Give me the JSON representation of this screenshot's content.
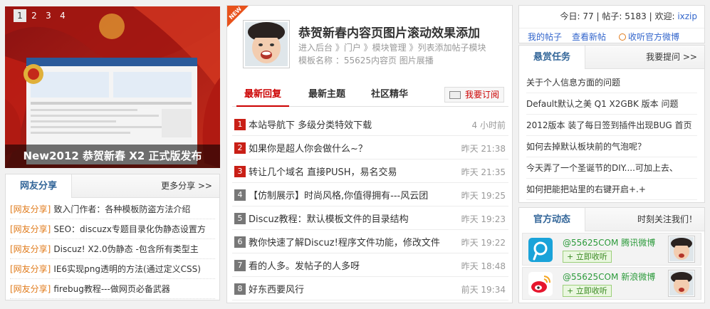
{
  "slider": {
    "pages": [
      "1",
      "2",
      "3",
      "4"
    ],
    "active_page": "1",
    "caption": "New2012 恭贺新春 X2 正式版发布"
  },
  "share": {
    "title": "网友分享",
    "more": "更多分享 >>",
    "items": [
      {
        "tag": "[网友分享]",
        "text": "致入门作者：各种模板防盗方法介绍"
      },
      {
        "tag": "[网友分享]",
        "text": "SEO：discuzx专题目录化伪静态设置方"
      },
      {
        "tag": "[网友分享]",
        "text": "Discuz! X2.0伪静态 -包含所有类型主"
      },
      {
        "tag": "[网友分享]",
        "text": "IE6实现png透明的方法(通过定义CSS)"
      },
      {
        "tag": "[网友分享]",
        "text": "firebug教程---做网页必备武器"
      }
    ]
  },
  "feature": {
    "badge": "NEW",
    "title": "恭贺新春内容页图片滚动效果添加",
    "crumb": "进入后台 》门户 》模块管理 》列表添加帖子模块",
    "template": "模板名称 ：55625内容页 图片展播"
  },
  "tabs": [
    {
      "label": "最新回复",
      "active": true
    },
    {
      "label": "最新主题",
      "active": false
    },
    {
      "label": "社区精华",
      "active": false
    }
  ],
  "subscribe_label": "我要订阅",
  "threads": [
    {
      "num": "1",
      "title": "本站导航下 多级分类特效下载",
      "time": "4 小时前",
      "hot": true
    },
    {
      "num": "2",
      "title": "如果你是超人你会做什么~？",
      "time": "昨天 21:38",
      "hot": true
    },
    {
      "num": "3",
      "title": "转让几个域名 直接PUSH，易名交易",
      "time": "昨天 21:35",
      "hot": true
    },
    {
      "num": "4",
      "title": "【仿制展示】时尚风格,你值得拥有---风云团",
      "time": "昨天 19:25",
      "hot": false
    },
    {
      "num": "5",
      "title": "Discuz教程：默认模板文件的目录结构",
      "time": "昨天 19:23",
      "hot": false
    },
    {
      "num": "6",
      "title": "教你快速了解Discuz!程序文件功能，修改文件",
      "time": "昨天 19:22",
      "hot": false
    },
    {
      "num": "7",
      "title": "看的人多。发帖子的人多呀",
      "time": "昨天 18:48",
      "hot": false
    },
    {
      "num": "8",
      "title": "好东西要风行",
      "time": "前天 19:34",
      "hot": false
    }
  ],
  "userbar": {
    "today": "今日: 77",
    "posts": "帖子: 5183",
    "welcome": "欢迎:",
    "username": "ixzip",
    "my_posts": "我的帖子",
    "view_new": "查看新帖",
    "listen_weibo": "收听官方微博"
  },
  "tasks": {
    "title": "悬赏任务",
    "more": "我要提问 >>",
    "items": [
      "关于个人信息方面的问题",
      "Default默认之美 Q1 X2GBK 版本 问题",
      "2012版本 装了每日签到插件出现BUG 首页",
      "如何去掉默认板块前的气泡呢？",
      "今天弄了一个圣诞节的DIY....可加上去、",
      "如何把能把站里的右键开启+.+"
    ]
  },
  "official": {
    "title": "官方动态",
    "more": "时刻关注我们！",
    "accounts": [
      {
        "logo": "qq-weibo-icon",
        "handle": "@55625COM",
        "platform": "腾讯微博",
        "follow": "+ 立即收听",
        "color": "#1aa3d9"
      },
      {
        "logo": "sina-weibo-icon",
        "handle": "@55625COM",
        "platform": "新浪微博",
        "follow": "+ 立即收听",
        "color": "#e6162d"
      }
    ]
  },
  "colors": {
    "accent": "#c91f16",
    "link": "#3366cc",
    "share_tag": "#e07a1a",
    "weibo_green": "#2b9a3a"
  }
}
